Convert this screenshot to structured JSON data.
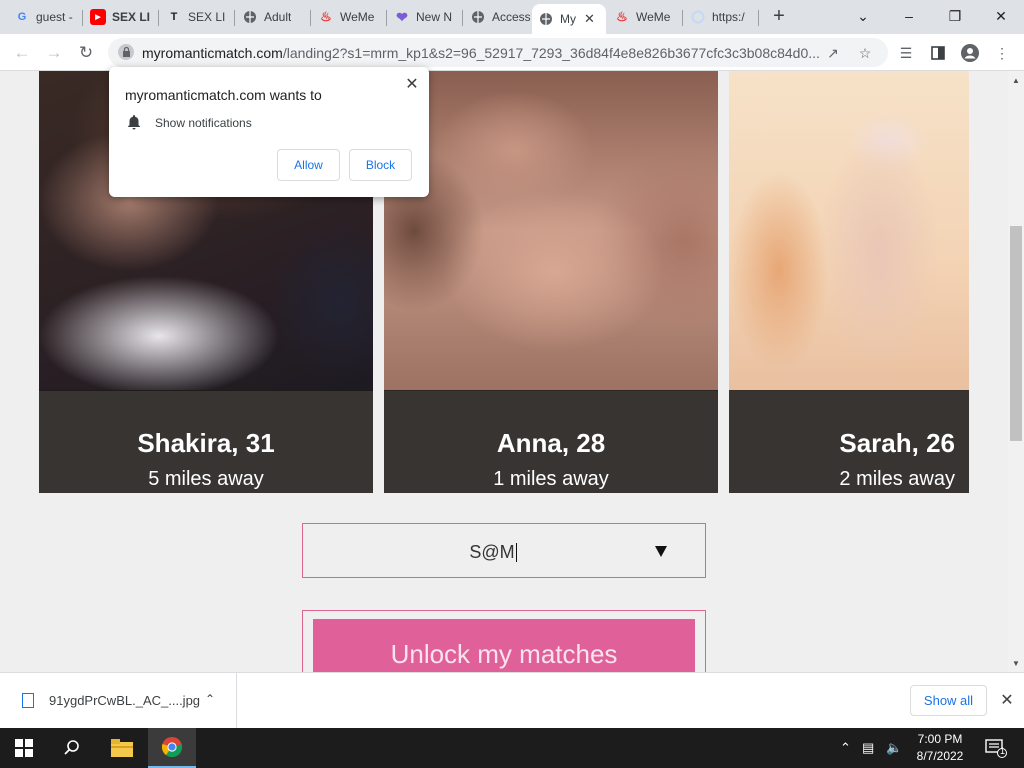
{
  "browser": {
    "tabs": [
      {
        "title": "guest -",
        "favicon": "google-icon"
      },
      {
        "title": "SEX LI",
        "favicon": "youtube-icon"
      },
      {
        "title": "SEX LI",
        "favicon": "t-icon"
      },
      {
        "title": "Adult",
        "favicon": "globe-icon"
      },
      {
        "title": "WeMe",
        "favicon": "flame-icon"
      },
      {
        "title": "New N",
        "favicon": "heart-icon"
      },
      {
        "title": "Access",
        "favicon": "globe-icon"
      },
      {
        "title": "My",
        "favicon": "globe-icon",
        "active": true
      },
      {
        "title": "WeMe",
        "favicon": "flame-icon"
      },
      {
        "title": "https:/",
        "favicon": "loading-icon"
      }
    ],
    "url_host": "myromanticmatch.com",
    "url_path": "/landing2?s1=mrm_kp1&s2=96_52917_7293_36d84f4e8e826b3677cfc3c3b08c84d0..."
  },
  "notification_popup": {
    "title": "myromanticmatch.com wants to",
    "permission": "Show notifications",
    "allow_label": "Allow",
    "block_label": "Block"
  },
  "profiles": [
    {
      "name": "Shakira, 31",
      "distance": "5 miles away"
    },
    {
      "name": "Anna, 28",
      "distance": "1 miles away"
    },
    {
      "name": "Sarah, 26",
      "distance": "2 miles away"
    }
  ],
  "form": {
    "select_value": "S@M",
    "unlock_label": "Unlock my matches"
  },
  "downloads": {
    "file_name": "91ygdPrCwBL._AC_....jpg",
    "show_all_label": "Show all"
  },
  "taskbar": {
    "time": "7:00 PM",
    "date": "8/7/2022",
    "notification_count": "1"
  },
  "colors": {
    "accent_pink": "#e0619a",
    "border_pink": "#d9678f",
    "link_blue": "#1a73e8"
  }
}
